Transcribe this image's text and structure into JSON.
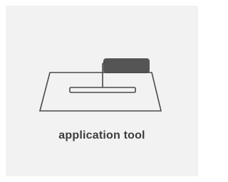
{
  "card": {
    "icon": "trowel-icon",
    "label": "application tool",
    "colors": {
      "background": "#f2f2f2",
      "icon_stroke": "#4a4a4a",
      "handle_fill": "#555555",
      "label": "#3c3c3c"
    }
  }
}
